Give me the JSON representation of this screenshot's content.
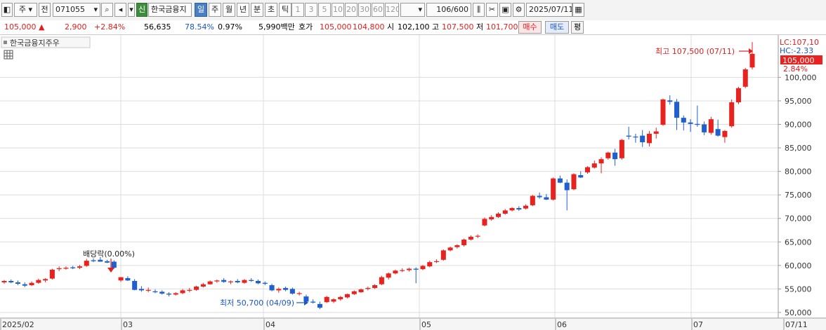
{
  "toolbar": {
    "market_code": "주",
    "prev_button": "전",
    "stock_code": "071055",
    "credit_badge": "신",
    "stock_name": "한국금융지",
    "periods": [
      "일",
      "주",
      "월",
      "년",
      "분",
      "초",
      "틱"
    ],
    "selected_period": "일",
    "intervals": [
      "1",
      "3",
      "5",
      "10",
      "20",
      "30",
      "60",
      "120"
    ],
    "count": "106",
    "count_max": "/600",
    "date": "2025/07/11"
  },
  "quote": {
    "price": "105,000",
    "change": "2,900",
    "change_pct": "+2.84%",
    "volume": "56,635",
    "vol_ratio": "78.54%",
    "turnover": "0.97%",
    "amount": "5,990백만",
    "bid_ask_label": "호가",
    "ask": "105,000",
    "bid": "104,800",
    "open_label": "시",
    "open": "102,100",
    "high_label": "고",
    "high": "107,500",
    "low_label": "저",
    "low": "101,700",
    "buy_label": "매수",
    "sell_label": "매도",
    "eval_label": "평"
  },
  "chart_meta": {
    "legend_title": "한국금융지주우",
    "high_label": "최고 107,500 (07/11)",
    "low_label": "최저 50,700 (04/09)",
    "dividend_label": "배당락(0.00%)",
    "lc_label": "LC:107,10",
    "hc_label": "HC:-2.33",
    "last_price_tag": "105,000",
    "last_pct_tag": "2.84%"
  },
  "colors": {
    "up": "#e8231f",
    "down": "#1f5fd0",
    "grid": "#dcdcdc",
    "price_tag_bg": "#e8231f"
  },
  "chart_data": {
    "type": "candlestick",
    "y_axis_ticks": [
      50000,
      55000,
      60000,
      65000,
      70000,
      75000,
      80000,
      85000,
      90000,
      95000,
      100000
    ],
    "y_axis_tick_labels": [
      "50,000",
      "55,000",
      "60,000",
      "65,000",
      "70,000",
      "75,000",
      "80,000",
      "85,000",
      "90,000",
      "95,000",
      "100,000"
    ],
    "ylim": [
      48800,
      109000
    ],
    "x_axis_labels": [
      "2025/02",
      "03",
      "04",
      "05",
      "06",
      "07",
      "07/11"
    ],
    "candles": [
      {
        "o": 56400,
        "h": 56900,
        "l": 56100,
        "c": 56700
      },
      {
        "o": 56700,
        "h": 57000,
        "l": 56200,
        "c": 56400
      },
      {
        "o": 56400,
        "h": 56800,
        "l": 55800,
        "c": 56100
      },
      {
        "o": 56000,
        "h": 56400,
        "l": 55400,
        "c": 55700
      },
      {
        "o": 55800,
        "h": 56600,
        "l": 55600,
        "c": 56300
      },
      {
        "o": 56300,
        "h": 57200,
        "l": 56100,
        "c": 56900
      },
      {
        "o": 56800,
        "h": 57300,
        "l": 56400,
        "c": 57100
      },
      {
        "o": 57200,
        "h": 59300,
        "l": 57000,
        "c": 59100
      },
      {
        "o": 59200,
        "h": 59800,
        "l": 58800,
        "c": 59400
      },
      {
        "o": 59300,
        "h": 59800,
        "l": 59100,
        "c": 59500
      },
      {
        "o": 59600,
        "h": 59900,
        "l": 59200,
        "c": 59400
      },
      {
        "o": 59500,
        "h": 60100,
        "l": 59200,
        "c": 59800
      },
      {
        "o": 59900,
        "h": 61400,
        "l": 59700,
        "c": 61000
      },
      {
        "o": 61100,
        "h": 61500,
        "l": 60700,
        "c": 60900
      },
      {
        "o": 61200,
        "h": 61800,
        "l": 60800,
        "c": 60800
      },
      {
        "o": 60900,
        "h": 61200,
        "l": 60500,
        "c": 60600
      },
      {
        "o": 60800,
        "h": 61100,
        "l": 59300,
        "c": 59500
      },
      {
        "o": 56800,
        "h": 57500,
        "l": 56500,
        "c": 57500
      },
      {
        "o": 57300,
        "h": 57700,
        "l": 56700,
        "c": 56800
      },
      {
        "o": 56700,
        "h": 57100,
        "l": 54700,
        "c": 54800
      },
      {
        "o": 55000,
        "h": 55600,
        "l": 54400,
        "c": 54700
      },
      {
        "o": 54700,
        "h": 55300,
        "l": 54300,
        "c": 54800
      },
      {
        "o": 54500,
        "h": 54900,
        "l": 54100,
        "c": 54300
      },
      {
        "o": 54400,
        "h": 54700,
        "l": 53800,
        "c": 54000
      },
      {
        "o": 54000,
        "h": 54300,
        "l": 53400,
        "c": 53800
      },
      {
        "o": 53800,
        "h": 54300,
        "l": 53600,
        "c": 54100
      },
      {
        "o": 54100,
        "h": 55000,
        "l": 53900,
        "c": 54700
      },
      {
        "o": 54700,
        "h": 55200,
        "l": 54300,
        "c": 54800
      },
      {
        "o": 54800,
        "h": 55700,
        "l": 54600,
        "c": 55500
      },
      {
        "o": 55500,
        "h": 56300,
        "l": 55300,
        "c": 56000
      },
      {
        "o": 56000,
        "h": 56800,
        "l": 55900,
        "c": 56600
      },
      {
        "o": 56600,
        "h": 57000,
        "l": 56300,
        "c": 56800
      },
      {
        "o": 56900,
        "h": 57300,
        "l": 56300,
        "c": 56500
      },
      {
        "o": 56500,
        "h": 56800,
        "l": 56000,
        "c": 56600
      },
      {
        "o": 56700,
        "h": 57100,
        "l": 56200,
        "c": 56400
      },
      {
        "o": 56300,
        "h": 57100,
        "l": 56100,
        "c": 56900
      },
      {
        "o": 56900,
        "h": 57300,
        "l": 56500,
        "c": 56700
      },
      {
        "o": 56700,
        "h": 57000,
        "l": 56000,
        "c": 56200
      },
      {
        "o": 56300,
        "h": 56600,
        "l": 55800,
        "c": 56100
      },
      {
        "o": 55800,
        "h": 56100,
        "l": 54500,
        "c": 54700
      },
      {
        "o": 54700,
        "h": 55300,
        "l": 54200,
        "c": 55000
      },
      {
        "o": 55200,
        "h": 55500,
        "l": 54500,
        "c": 54800
      },
      {
        "o": 55000,
        "h": 55300,
        "l": 53800,
        "c": 54000
      },
      {
        "o": 54000,
        "h": 54400,
        "l": 53600,
        "c": 54100
      },
      {
        "o": 53400,
        "h": 53800,
        "l": 52100,
        "c": 52300
      },
      {
        "o": 52300,
        "h": 52800,
        "l": 51900,
        "c": 52100
      },
      {
        "o": 51800,
        "h": 52300,
        "l": 50700,
        "c": 51000
      },
      {
        "o": 52200,
        "h": 53500,
        "l": 52000,
        "c": 53300
      },
      {
        "o": 52300,
        "h": 53000,
        "l": 52000,
        "c": 52800
      },
      {
        "o": 52800,
        "h": 53500,
        "l": 52500,
        "c": 53300
      },
      {
        "o": 53200,
        "h": 54000,
        "l": 53000,
        "c": 53900
      },
      {
        "o": 53900,
        "h": 54700,
        "l": 53700,
        "c": 54500
      },
      {
        "o": 54300,
        "h": 55100,
        "l": 54200,
        "c": 54900
      },
      {
        "o": 55000,
        "h": 55500,
        "l": 54700,
        "c": 55200
      },
      {
        "o": 55200,
        "h": 56000,
        "l": 55000,
        "c": 55800
      },
      {
        "o": 56000,
        "h": 57800,
        "l": 55800,
        "c": 57500
      },
      {
        "o": 57400,
        "h": 58500,
        "l": 57000,
        "c": 58300
      },
      {
        "o": 58300,
        "h": 59100,
        "l": 58100,
        "c": 58900
      },
      {
        "o": 58900,
        "h": 59400,
        "l": 58600,
        "c": 59000
      },
      {
        "o": 59000,
        "h": 59500,
        "l": 58700,
        "c": 59300
      },
      {
        "o": 59300,
        "h": 59600,
        "l": 56200,
        "c": 59100
      },
      {
        "o": 59200,
        "h": 60100,
        "l": 59000,
        "c": 59900
      },
      {
        "o": 59800,
        "h": 61000,
        "l": 59600,
        "c": 60700
      },
      {
        "o": 60800,
        "h": 61300,
        "l": 60500,
        "c": 60900
      },
      {
        "o": 61200,
        "h": 63400,
        "l": 61000,
        "c": 63200
      },
      {
        "o": 63200,
        "h": 64000,
        "l": 63000,
        "c": 63800
      },
      {
        "o": 63900,
        "h": 64500,
        "l": 63600,
        "c": 64300
      },
      {
        "o": 64300,
        "h": 65700,
        "l": 64000,
        "c": 65500
      },
      {
        "o": 65500,
        "h": 66400,
        "l": 65300,
        "c": 66100
      },
      {
        "o": 66200,
        "h": 66600,
        "l": 65800,
        "c": 66300
      },
      {
        "o": 68500,
        "h": 70200,
        "l": 68300,
        "c": 69900
      },
      {
        "o": 69800,
        "h": 70700,
        "l": 69500,
        "c": 70300
      },
      {
        "o": 70300,
        "h": 71300,
        "l": 70100,
        "c": 71000
      },
      {
        "o": 71000,
        "h": 72000,
        "l": 70800,
        "c": 71700
      },
      {
        "o": 71700,
        "h": 72400,
        "l": 71500,
        "c": 72200
      },
      {
        "o": 72200,
        "h": 72600,
        "l": 71600,
        "c": 71900
      },
      {
        "o": 72100,
        "h": 73000,
        "l": 71900,
        "c": 72700
      },
      {
        "o": 72800,
        "h": 75000,
        "l": 72600,
        "c": 74800
      },
      {
        "o": 74800,
        "h": 75500,
        "l": 74200,
        "c": 74500
      },
      {
        "o": 74500,
        "h": 75200,
        "l": 73900,
        "c": 74000
      },
      {
        "o": 74000,
        "h": 78700,
        "l": 73800,
        "c": 78500
      },
      {
        "o": 78500,
        "h": 79100,
        "l": 77500,
        "c": 77600
      },
      {
        "o": 77600,
        "h": 78300,
        "l": 71700,
        "c": 76000
      },
      {
        "o": 76200,
        "h": 79600,
        "l": 76000,
        "c": 79400
      },
      {
        "o": 79200,
        "h": 80000,
        "l": 78600,
        "c": 78700
      },
      {
        "o": 79800,
        "h": 81100,
        "l": 79500,
        "c": 80900
      },
      {
        "o": 80800,
        "h": 82300,
        "l": 80600,
        "c": 81700
      },
      {
        "o": 81700,
        "h": 83000,
        "l": 79600,
        "c": 82600
      },
      {
        "o": 82800,
        "h": 84200,
        "l": 82500,
        "c": 84000
      },
      {
        "o": 84000,
        "h": 84800,
        "l": 81200,
        "c": 82600
      },
      {
        "o": 82800,
        "h": 86900,
        "l": 82500,
        "c": 86700
      },
      {
        "o": 87600,
        "h": 89500,
        "l": 86800,
        "c": 87400
      },
      {
        "o": 87400,
        "h": 88000,
        "l": 86100,
        "c": 87300
      },
      {
        "o": 87600,
        "h": 88800,
        "l": 85200,
        "c": 86200
      },
      {
        "o": 86000,
        "h": 88600,
        "l": 85300,
        "c": 88000
      },
      {
        "o": 88000,
        "h": 89300,
        "l": 87000,
        "c": 88500
      },
      {
        "o": 89900,
        "h": 95500,
        "l": 89700,
        "c": 95300
      },
      {
        "o": 95100,
        "h": 96200,
        "l": 94200,
        "c": 94800
      },
      {
        "o": 94800,
        "h": 95400,
        "l": 88800,
        "c": 91400
      },
      {
        "o": 91400,
        "h": 91900,
        "l": 88700,
        "c": 90400
      },
      {
        "o": 90400,
        "h": 91100,
        "l": 88400,
        "c": 90100
      },
      {
        "o": 90100,
        "h": 94000,
        "l": 89500,
        "c": 89900
      },
      {
        "o": 90000,
        "h": 90600,
        "l": 87700,
        "c": 88300
      },
      {
        "o": 88200,
        "h": 91600,
        "l": 87800,
        "c": 91100
      },
      {
        "o": 89000,
        "h": 91000,
        "l": 87400,
        "c": 87600
      },
      {
        "o": 87300,
        "h": 88800,
        "l": 86100,
        "c": 88600
      },
      {
        "o": 89600,
        "h": 95300,
        "l": 89300,
        "c": 94700
      },
      {
        "o": 94700,
        "h": 98000,
        "l": 94300,
        "c": 97700
      },
      {
        "o": 98000,
        "h": 102000,
        "l": 97700,
        "c": 101700
      },
      {
        "o": 102100,
        "h": 107500,
        "l": 101700,
        "c": 105000
      }
    ]
  }
}
